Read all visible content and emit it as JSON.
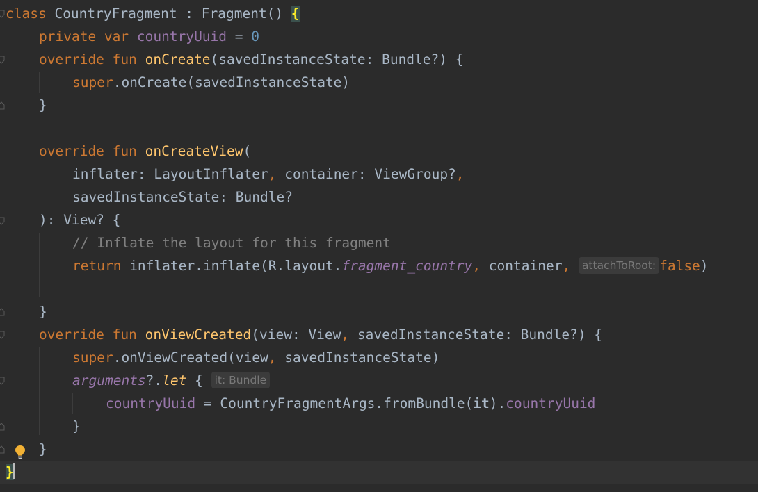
{
  "editor": {
    "lines": {
      "l1": {
        "t1": "class ",
        "t2": "CountryFragment : Fragment() ",
        "t3": "{"
      },
      "l2": {
        "t1": "private var ",
        "t2": "countryUuid",
        "t3": " = ",
        "t4": "0"
      },
      "l3": {
        "t1": "override fun ",
        "t2": "onCreate",
        "t3": "(savedInstanceState: Bundle?) {"
      },
      "l4": {
        "t1": "super",
        "t2": ".onCreate(savedInstanceState)"
      },
      "l5": {
        "t1": "}"
      },
      "l7": {
        "t1": "override fun ",
        "t2": "onCreateView",
        "t3": "("
      },
      "l8": {
        "t1": "inflater: LayoutInflater",
        "t2": ",",
        "t3": " container: ViewGroup?",
        "t4": ","
      },
      "l9": {
        "t1": "savedInstanceState: Bundle?"
      },
      "l10": {
        "t1": "): View? {"
      },
      "l11": {
        "t1": "// Inflate the layout for this fragment"
      },
      "l12": {
        "t1": "return ",
        "t2": "inflater.inflate(R.layout.",
        "t3": "fragment_country",
        "t4": ",",
        "t5": " container",
        "t6": ",",
        "t7": "false",
        "t8": ")"
      },
      "l14": {
        "t1": "}"
      },
      "l15": {
        "t1": "override fun ",
        "t2": "onViewCreated",
        "t3": "(view: View",
        "t4": ",",
        "t5": " savedInstanceState: Bundle?) {"
      },
      "l16": {
        "t1": "super",
        "t2": ".onViewCreated(view",
        "t3": ",",
        "t4": " savedInstanceState)"
      },
      "l17": {
        "t1": "arguments",
        "t2": "?.",
        "t3": "let",
        "t4": " {"
      },
      "l18": {
        "t1": "countryUuid",
        "t2": " = CountryFragmentArgs.fromBundle(",
        "t3": "it",
        "t4": ").",
        "t5": "countryUuid"
      },
      "l19": {
        "t1": "}"
      },
      "l20": {
        "t1": "}"
      },
      "l21": {
        "t1": "}"
      }
    },
    "hints": {
      "attach_to_root": "attachToRoot:",
      "it_type": "it: Bundle"
    },
    "icons": {
      "fold": "fold-marker-icon",
      "bulb": "lightbulb-icon"
    },
    "colors": {
      "background": "#2b2b2b",
      "keyword": "#cc7832",
      "function": "#ffc66d",
      "number": "#6897bb",
      "property": "#9876aa",
      "comment": "#808080",
      "text": "#a9b7c6",
      "current_line": "#323232"
    }
  }
}
